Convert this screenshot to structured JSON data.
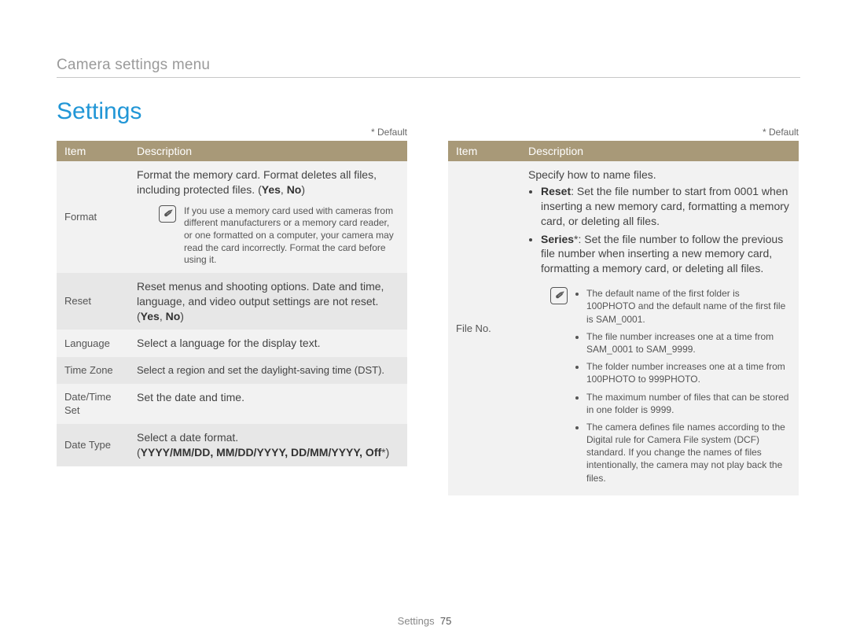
{
  "breadcrumb": "Camera settings menu",
  "title": "Settings",
  "default_label": "* Default",
  "header_item": "Item",
  "header_desc": "Description",
  "note_icon": "✐",
  "left": {
    "format": {
      "item": "Format",
      "text1": "Format the memory card. Format deletes all files, including protected files. (",
      "bold1": "Yes",
      "sep": ", ",
      "bold2": "No",
      "text2": ")",
      "note": "If you use a memory card used with cameras from different manufacturers or a memory card reader, or one formatted on a computer, your camera may read the card incorrectly. Format the card before using it."
    },
    "reset": {
      "item": "Reset",
      "text1": "Reset menus and shooting options. Date and time, language, and video output settings are not reset.",
      "open": "(",
      "bold1": "Yes",
      "sep": ", ",
      "bold2": "No",
      "close": ")"
    },
    "language": {
      "item": "Language",
      "desc": "Select a language for the display text."
    },
    "timezone": {
      "item": "Time Zone",
      "desc": "Select a region and set the daylight-saving time (DST)."
    },
    "datetime": {
      "item": "Date/Time Set",
      "desc": "Set the date and time."
    },
    "datetype": {
      "item": "Date Type",
      "text1": "Select a date format.",
      "open": "(",
      "bold": "YYYY/MM/DD, MM/DD/YYYY, DD/MM/YYYY, Off",
      "after": "*)"
    }
  },
  "right": {
    "fileno": {
      "item": "File No.",
      "intro": "Specify how to name files.",
      "reset_label": "Reset",
      "reset_text": ": Set the file number to start from 0001 when inserting a new memory card, formatting a memory card, or deleting all files.",
      "series_label": "Series",
      "series_text": "*: Set the file number to follow the previous file number when inserting a new memory card, formatting a memory card, or deleting all files.",
      "n1": "The default name of the first folder is 100PHOTO and the default name of the first file is SAM_0001.",
      "n2": "The file number increases one at a time from SAM_0001 to SAM_9999.",
      "n3": "The folder number increases one at a time from 100PHOTO to 999PHOTO.",
      "n4": "The maximum number of files that can be stored in one folder is 9999.",
      "n5": "The camera defines file names according to the Digital rule for Camera File system (DCF) standard. If you change the names of files intentionally, the camera may not play back the files."
    }
  },
  "footer_label": "Settings",
  "footer_page": "75"
}
